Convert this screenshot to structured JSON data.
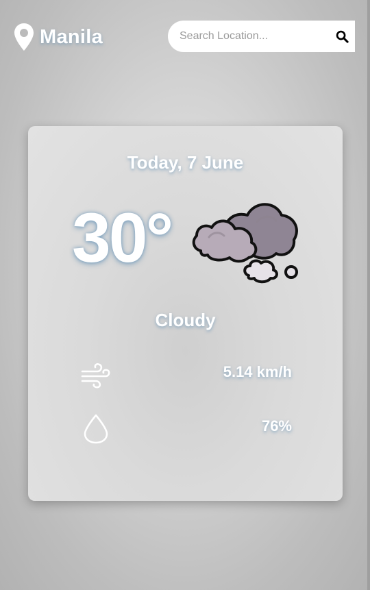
{
  "header": {
    "location_name": "Manila",
    "location_icon": "map-pin-icon",
    "search": {
      "placeholder": "Search Location...",
      "value": "",
      "button_icon": "search-icon"
    }
  },
  "weather": {
    "date": "Today, 7 June",
    "temperature": "30°",
    "condition": "Cloudy",
    "condition_icon": "cloudy-icon",
    "wind": {
      "icon": "wind-icon",
      "value": "5.14 km/h"
    },
    "humidity": {
      "icon": "water-drop-icon",
      "value": "76%"
    }
  },
  "colors": {
    "text": "#ffffff",
    "text_glow": "#5a8cb4",
    "cloud_dark": "#8f8594",
    "cloud_light": "#c0b6c1",
    "outline": "#111111"
  }
}
